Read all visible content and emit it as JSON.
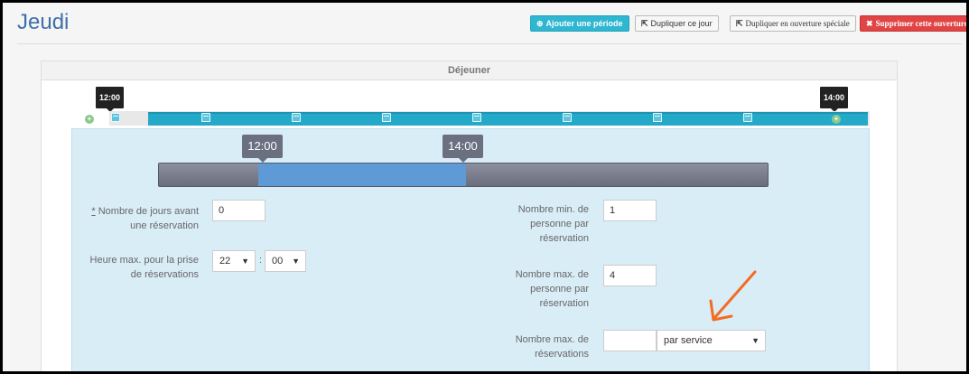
{
  "page": {
    "title": "Jeudi"
  },
  "toolbar": {
    "add_period": "Ajouter une période",
    "duplicate_day": "Dupliquer ce jour",
    "duplicate_special": "Dupliquer en ouverture spéciale",
    "delete_opening": "Supprimer cette ouverture"
  },
  "panel": {
    "title": "Déjeuner",
    "timeline_start": "12:00",
    "timeline_end": "14:00",
    "slider": {
      "from": "12:00",
      "to": "14:00"
    }
  },
  "form": {
    "days_before": {
      "required_mark": "*",
      "label": "Nombre de jours avant une réservation",
      "value": "0"
    },
    "max_hour": {
      "label": "Heure max. pour la prise de réservations",
      "hour": "22",
      "separator": ":",
      "minute": "00"
    },
    "min_persons": {
      "label": "Nombre min. de personne par réservation",
      "value": "1"
    },
    "max_persons": {
      "label": "Nombre max. de personne par réservation",
      "value": "4"
    },
    "max_reservations": {
      "label": "Nombre max. de réservations",
      "value": "",
      "mode": "par service"
    }
  },
  "colors": {
    "accent": "#24a9c9",
    "range": "#5d9ad6",
    "danger": "#e04444",
    "arrow": "#f36c21"
  },
  "icons": [
    "plus-circle-icon",
    "share-icon",
    "times-icon",
    "calendar-icon",
    "chevron-down-icon"
  ]
}
